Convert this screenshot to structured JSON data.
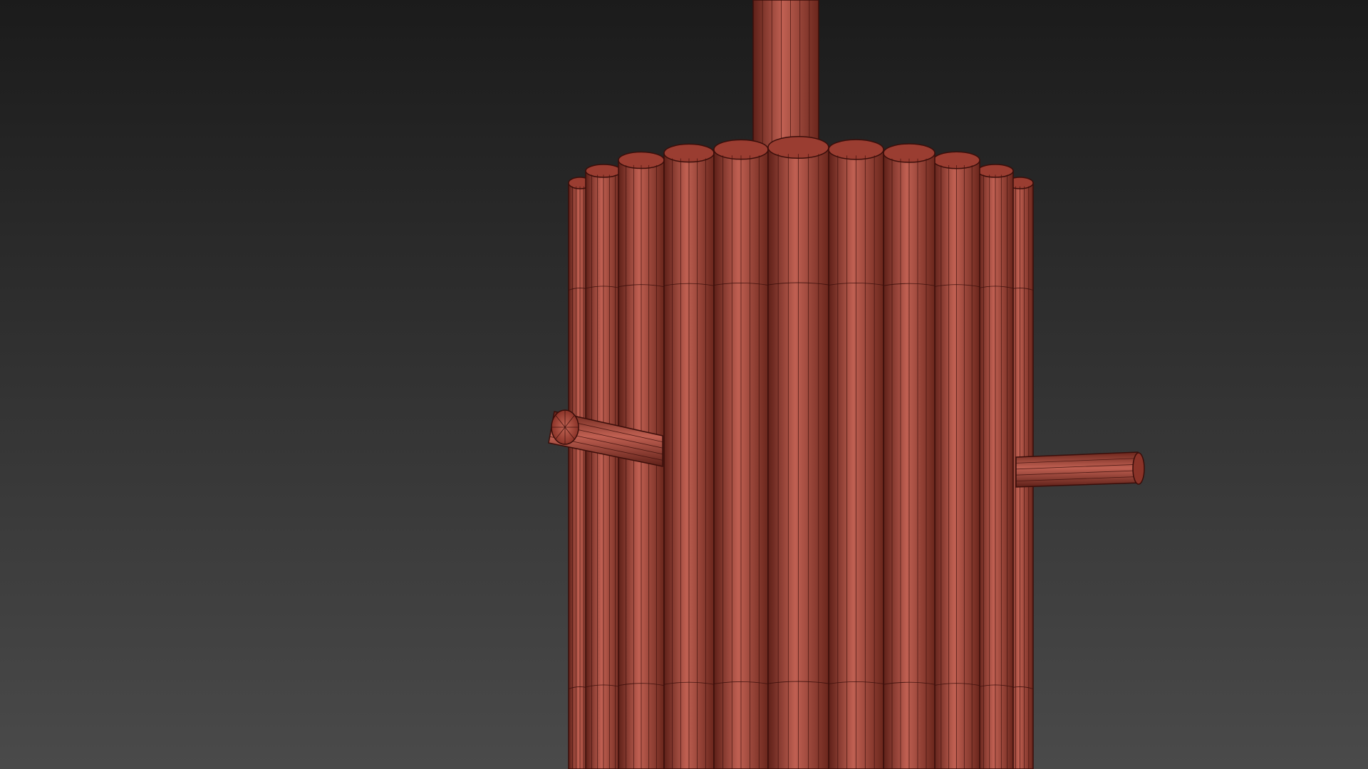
{
  "viewport": {
    "background_top_color": "#1b1b1b",
    "background_bottom_color": "#4a4a4a"
  },
  "model": {
    "shading": "wireframe-on-shaded",
    "base_color": "#a5463a",
    "highlight_color": "#c06052",
    "shadow_color": "#5e2018",
    "wire_color": "#3a0e0a"
  }
}
